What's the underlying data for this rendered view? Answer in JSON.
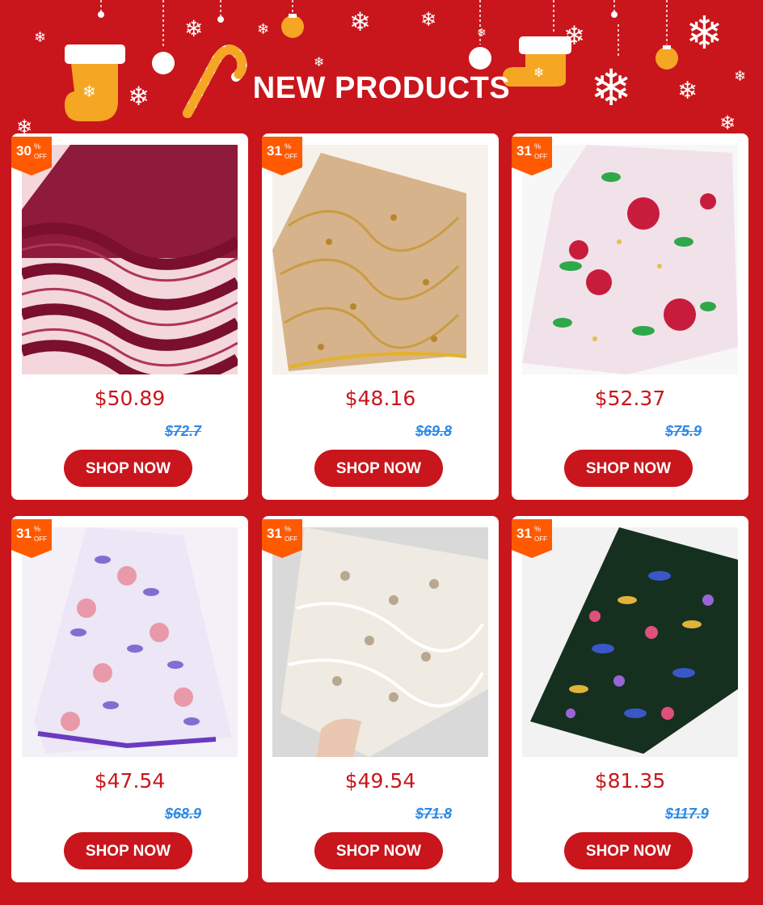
{
  "banner": {
    "title": "NEW PRODUCTS"
  },
  "colors": {
    "background": "#c8161c",
    "card": "#ffffff",
    "badge": "#ff5a00",
    "old_price": "#2e8ae6"
  },
  "products": [
    {
      "discount": "30",
      "percent_symbol": "%",
      "off_label": "OFF",
      "price": "$50.89",
      "old_price": "$72.7",
      "button": "SHOP NOW",
      "image": "burgundy sequin lace fabric"
    },
    {
      "discount": "31",
      "percent_symbol": "%",
      "off_label": "OFF",
      "price": "$48.16",
      "old_price": "$69.8",
      "button": "SHOP NOW",
      "image": "gold embroidered lace fabric"
    },
    {
      "discount": "31",
      "percent_symbol": "%",
      "off_label": "OFF",
      "price": "$52.37",
      "old_price": "$75.9",
      "button": "SHOP NOW",
      "image": "floral print fabric red green"
    },
    {
      "discount": "31",
      "percent_symbol": "%",
      "off_label": "OFF",
      "price": "$47.54",
      "old_price": "$68.9",
      "button": "SHOP NOW",
      "image": "lilac pink floral fabric"
    },
    {
      "discount": "31",
      "percent_symbol": "%",
      "off_label": "OFF",
      "price": "$49.54",
      "old_price": "$71.8",
      "button": "SHOP NOW",
      "image": "white silver sequin lace fabric"
    },
    {
      "discount": "31",
      "percent_symbol": "%",
      "off_label": "OFF",
      "price": "$81.35",
      "old_price": "$117.9",
      "button": "SHOP NOW",
      "image": "dark green multicolor sequin fabric"
    }
  ]
}
